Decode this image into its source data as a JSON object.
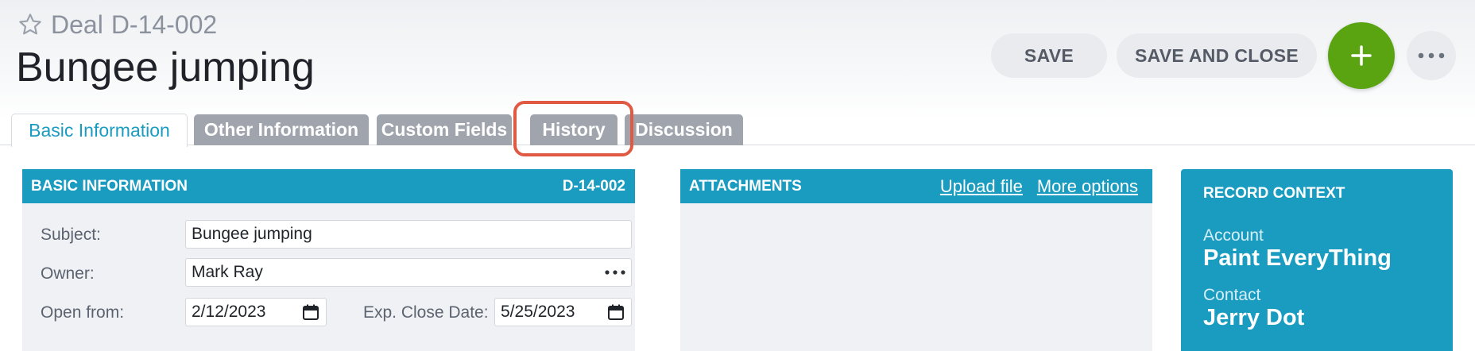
{
  "header": {
    "deal_prefix": "Deal",
    "deal_id": "D-14-002",
    "title": "Bungee jumping",
    "save_label": "SAVE",
    "save_close_label": "SAVE AND CLOSE"
  },
  "tabs": [
    {
      "label": "Basic Information",
      "active": true
    },
    {
      "label": "Other Information"
    },
    {
      "label": "Custom Fields"
    },
    {
      "label": "History",
      "highlighted": true
    },
    {
      "label": "Discussion"
    }
  ],
  "basic_info": {
    "title": "BASIC INFORMATION",
    "record_id": "D-14-002",
    "subject_label": "Subject:",
    "subject_value": "Bungee jumping",
    "owner_label": "Owner:",
    "owner_value": "Mark Ray",
    "open_from_label": "Open from:",
    "open_from_value": "2/12/2023",
    "close_date_label": "Exp. Close Date:",
    "close_date_value": "5/25/2023"
  },
  "attachments": {
    "title": "ATTACHMENTS",
    "upload_label": "Upload file",
    "more_label": "More options"
  },
  "record_context": {
    "title": "RECORD CONTEXT",
    "account_label": "Account",
    "account_value": "Paint EveryThing",
    "contact_label": "Contact",
    "contact_value": "Jerry Dot"
  },
  "colors": {
    "accent": "#1a9cc1",
    "add_button": "#5aa412",
    "highlight": "#e05a43"
  },
  "icons": [
    "star-icon",
    "plus-icon",
    "more-horizontal-icon",
    "ellipsis-icon",
    "calendar-icon"
  ]
}
